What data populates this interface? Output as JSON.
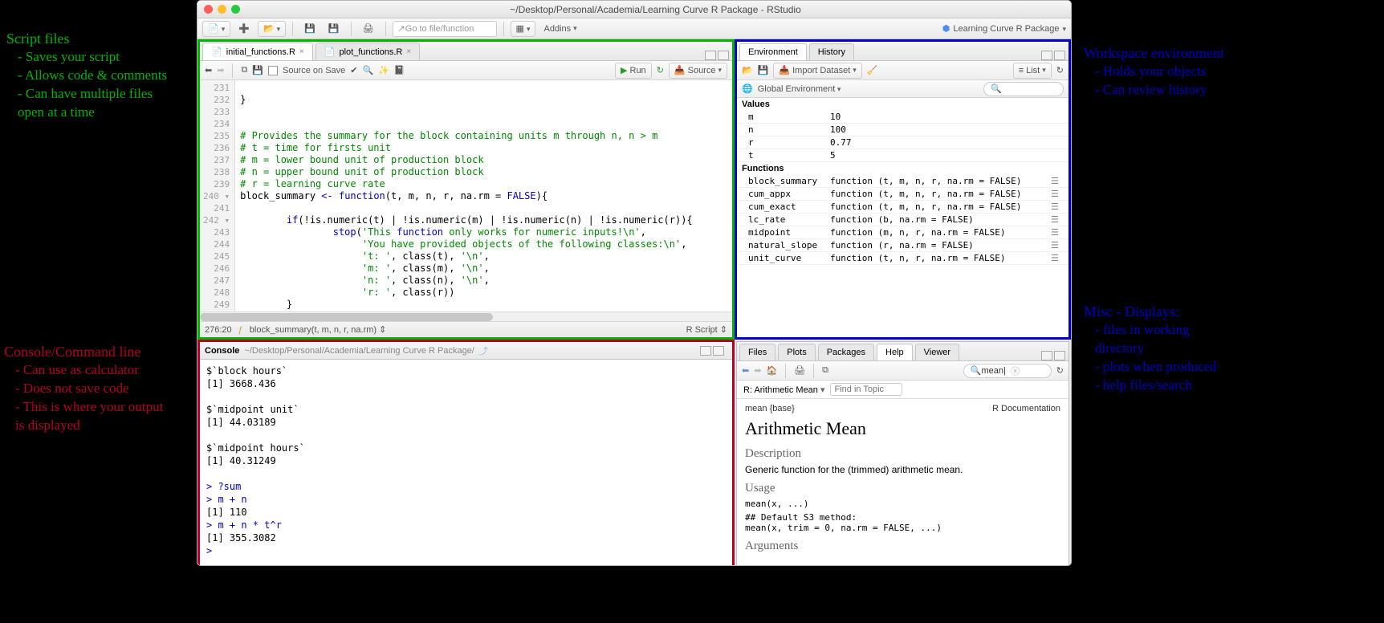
{
  "window_title": "~/Desktop/Personal/Academia/Learning Curve R Package - RStudio",
  "main_toolbar": {
    "goto_placeholder": "Go to file/function",
    "addins": "Addins",
    "project": "Learning Curve R Package"
  },
  "editor": {
    "tabs": [
      "initial_functions.R",
      "plot_functions.R"
    ],
    "save_on_source": "Source on Save",
    "run": "Run",
    "source": "Source",
    "lines_start": 231,
    "lines": [
      "",
      "}",
      "",
      "",
      "# Provides the summary for the block containing units m through n, n > m",
      "# t = time for firsts unit",
      "# m = lower bound unit of production block",
      "# n = upper bound unit of production block",
      "# r = learning curve rate",
      "block_summary <- function(t, m, n, r, na.rm = FALSE){",
      "",
      "        if(!is.numeric(t) | !is.numeric(m) | !is.numeric(n) | !is.numeric(r)){",
      "                stop('This function only works for numeric inputs!\\n',",
      "                     'You have provided objects of the following classes:\\n',",
      "                     't: ', class(t), '\\n',",
      "                     'm: ', class(m), '\\n',",
      "                     'n: ', class(n), '\\n',",
      "                     'r: ', class(r))",
      "        }",
      ""
    ],
    "cursor": "276:20",
    "func_nav": "block_summary(t, m, n, r, na.rm)",
    "lang": "R Script"
  },
  "console": {
    "title": "Console",
    "path": "~/Desktop/Personal/Academia/Learning Curve R Package/",
    "lines": [
      {
        "t": "out",
        "v": "$`block hours`"
      },
      {
        "t": "out",
        "v": "[1] 3668.436"
      },
      {
        "t": "out",
        "v": ""
      },
      {
        "t": "out",
        "v": "$`midpoint unit`"
      },
      {
        "t": "out",
        "v": "[1] 44.03189"
      },
      {
        "t": "out",
        "v": ""
      },
      {
        "t": "out",
        "v": "$`midpoint hours`"
      },
      {
        "t": "out",
        "v": "[1] 40.31249"
      },
      {
        "t": "out",
        "v": ""
      },
      {
        "t": "in",
        "v": "> ?sum"
      },
      {
        "t": "in",
        "v": "> m + n"
      },
      {
        "t": "out",
        "v": "[1] 110"
      },
      {
        "t": "in",
        "v": "> m + n * t^r"
      },
      {
        "t": "out",
        "v": "[1] 355.3082"
      },
      {
        "t": "in",
        "v": "> "
      }
    ]
  },
  "env": {
    "tabs": [
      "Environment",
      "History"
    ],
    "import": "Import Dataset",
    "list": "List",
    "scope": "Global Environment",
    "values_header": "Values",
    "values": [
      {
        "n": "m",
        "v": "10"
      },
      {
        "n": "n",
        "v": "100"
      },
      {
        "n": "r",
        "v": "0.77"
      },
      {
        "n": "t",
        "v": "5"
      }
    ],
    "functions_header": "Functions",
    "functions": [
      {
        "n": "block_summary",
        "v": "function (t, m, n, r, na.rm = FALSE)"
      },
      {
        "n": "cum_appx",
        "v": "function (t, m, n, r, na.rm = FALSE)"
      },
      {
        "n": "cum_exact",
        "v": "function (t, m, n, r, na.rm = FALSE)"
      },
      {
        "n": "lc_rate",
        "v": "function (b, na.rm = FALSE)"
      },
      {
        "n": "midpoint",
        "v": "function (m, n, r, na.rm = FALSE)"
      },
      {
        "n": "natural_slope",
        "v": "function (r, na.rm = FALSE)"
      },
      {
        "n": "unit_curve",
        "v": "function (t, n, r, na.rm = FALSE)"
      }
    ]
  },
  "help": {
    "tabs": [
      "Files",
      "Plots",
      "Packages",
      "Help",
      "Viewer"
    ],
    "search_value": "mean",
    "topic_dd": "R: Arithmetic Mean",
    "find_placeholder": "Find in Topic",
    "pkg": "mean {base}",
    "doc": "R Documentation",
    "title": "Arithmetic Mean",
    "desc_h": "Description",
    "desc": "Generic function for the (trimmed) arithmetic mean.",
    "usage_h": "Usage",
    "usage1": "mean(x, ...)",
    "usage2": "## Default S3 method:\nmean(x, trim = 0, na.rm = FALSE, ...)",
    "args_h": "Arguments"
  },
  "annotations": {
    "script_title": "Script files",
    "script_lines": [
      "- Saves your script",
      "- Allows code & comments",
      "- Can have multiple files",
      "   open at a time"
    ],
    "env_title": "Workspace environment",
    "env_lines": [
      "- Holds your objects",
      "- Can review history"
    ],
    "console_title": "Console/Command line",
    "console_lines": [
      "- Can use as calculator",
      "- Does not save code",
      "- This is where your output",
      "   is displayed"
    ],
    "misc_title": "Misc - Displays:",
    "misc_lines": [
      "- files in working",
      "   directory",
      "- plots when produced",
      "- help files/search"
    ]
  }
}
